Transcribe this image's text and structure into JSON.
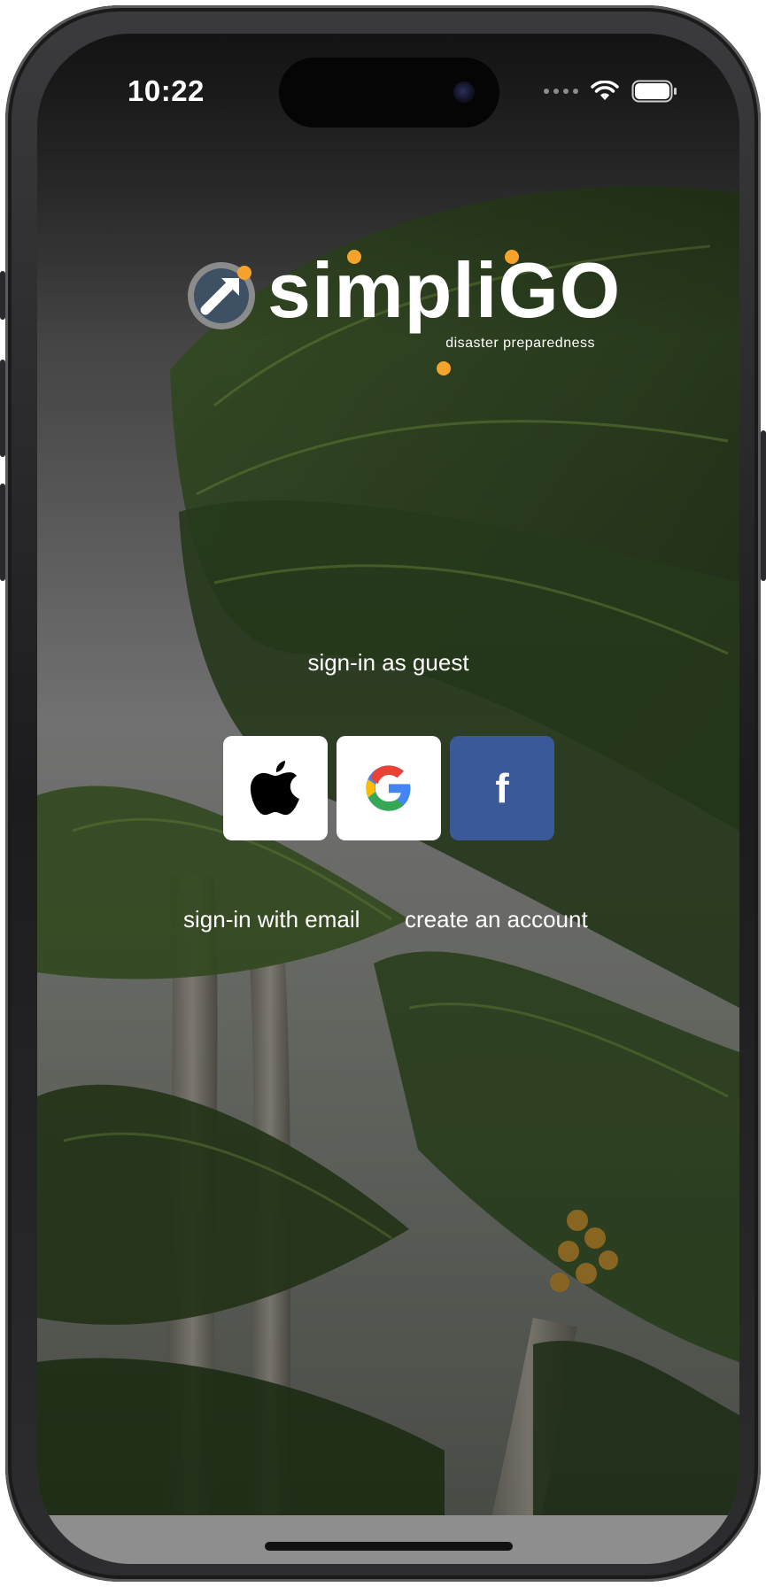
{
  "status_bar": {
    "time": "10:22",
    "wifi_icon": "wifi-icon",
    "battery_icon": "battery-icon"
  },
  "logo": {
    "wordmark": "simpliGO",
    "tagline": "disaster preparedness",
    "accent_color": "#f5a32a",
    "badge_color": "#3e5064"
  },
  "auth": {
    "guest_label": "sign-in as guest",
    "email_label": "sign-in with email",
    "create_label": "create an account",
    "facebook_glyph": "f"
  },
  "social_buttons": [
    {
      "provider": "apple",
      "icon": "apple-icon",
      "background": "#ffffff"
    },
    {
      "provider": "google",
      "icon": "google-icon",
      "background": "#ffffff"
    },
    {
      "provider": "facebook",
      "icon": "facebook-icon",
      "background": "#3b5998"
    }
  ],
  "background": {
    "icon": "palm-trees-background"
  }
}
